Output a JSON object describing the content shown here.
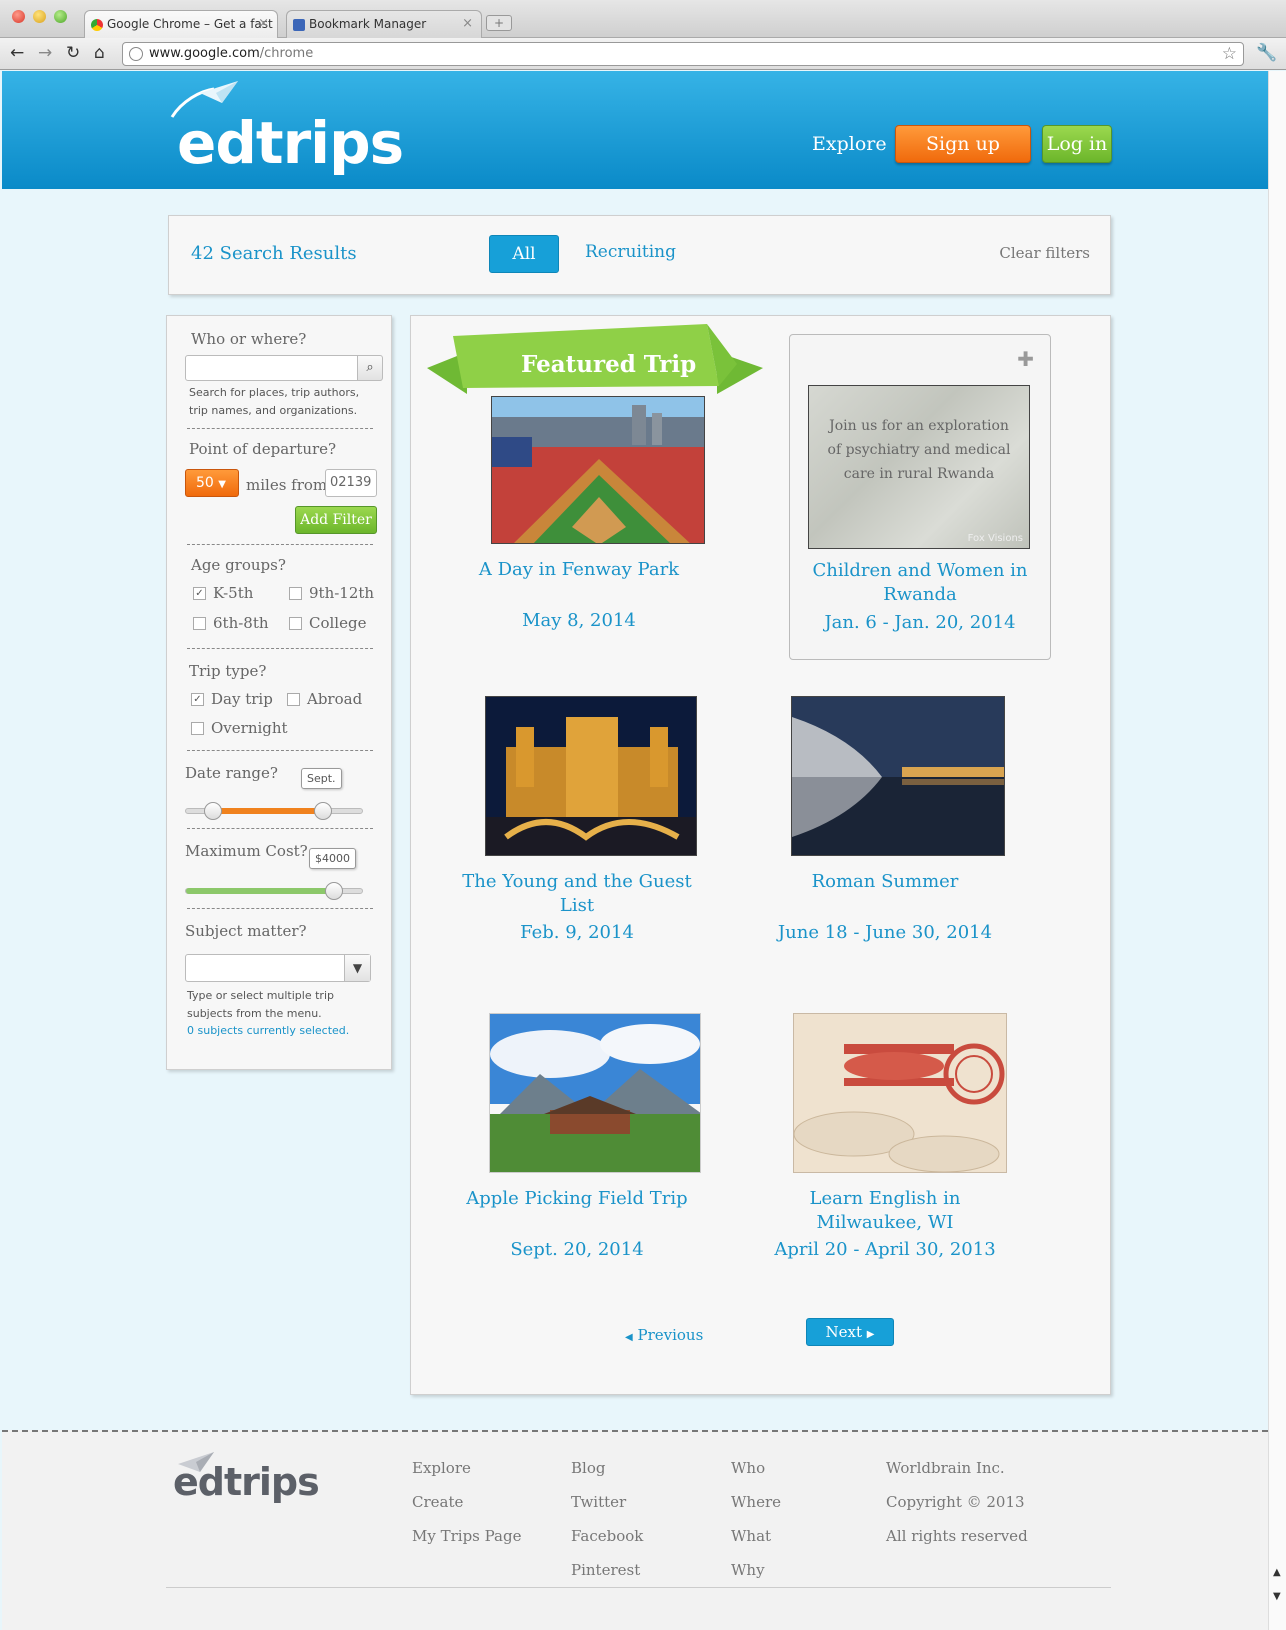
{
  "browser": {
    "tabs": [
      {
        "title": "Google Chrome – Get a fast ..."
      },
      {
        "title": "Bookmark Manager"
      }
    ],
    "url_host": "www.google.com",
    "url_path": "/chrome"
  },
  "header": {
    "logo": "edtrips",
    "explore": "Explore",
    "signup": "Sign up",
    "login": "Log in"
  },
  "results_bar": {
    "count": "42 Search Results",
    "tab_all": "All",
    "tab_recruiting": "Recruiting",
    "clear": "Clear filters"
  },
  "sidebar": {
    "who_label": "Who or where?",
    "who_help": "Search for places, trip authors, trip names, and organizations.",
    "departure_label": "Point of departure?",
    "miles_value": "50",
    "miles_text": "miles from",
    "zip_value": "02139",
    "add_filter": "Add Filter",
    "age_label": "Age groups?",
    "age_options": [
      {
        "label": "K-5th",
        "checked": true
      },
      {
        "label": "9th-12th",
        "checked": false
      },
      {
        "label": "6th-8th",
        "checked": false
      },
      {
        "label": "College",
        "checked": false
      }
    ],
    "trip_type_label": "Trip type?",
    "trip_type_options": [
      {
        "label": "Day trip",
        "checked": true
      },
      {
        "label": "Abroad",
        "checked": false
      },
      {
        "label": "Overnight",
        "checked": false
      }
    ],
    "date_label": "Date range?",
    "date_tooltip": "Sept.",
    "date_range": {
      "start": 0.15,
      "end": 0.77
    },
    "cost_label": "Maximum Cost?",
    "cost_tooltip": "$4000",
    "cost_level": 0.83,
    "subject_label": "Subject matter?",
    "subject_help": "Type or select multiple trip subjects from the menu.",
    "subject_status": "0 subjects currently selected."
  },
  "trips": {
    "featured_label": "Featured Trip",
    "items": [
      {
        "title": "A Day in Fenway Park",
        "date": "May 8, 2014"
      },
      {
        "title": "Children and Women in Rwanda",
        "date": "Jan. 6 - Jan. 20, 2014",
        "blurb": "Join us for an exploration of psychiatry and medical care in rural Rwanda",
        "credit": "Fox Visions"
      },
      {
        "title": "The Young and the Guest List",
        "date": "Feb. 9, 2014"
      },
      {
        "title": "Roman Summer",
        "date": "June 18 - June 30, 2014"
      },
      {
        "title": "Apple Picking Field Trip",
        "date": "Sept. 20, 2014"
      },
      {
        "title": "Learn English in Milwaukee, WI",
        "date": "April 20 - April 30, 2013"
      }
    ]
  },
  "pager": {
    "prev": "Previous",
    "next": "Next"
  },
  "footer": {
    "logo": "edtrips",
    "col1": [
      "Explore",
      "Create",
      "My Trips Page"
    ],
    "col2": [
      "Blog",
      "Twitter",
      "Facebook",
      "Pinterest"
    ],
    "col3": [
      "Who",
      "Where",
      "What",
      "Why"
    ],
    "col4": [
      "Worldbrain Inc.",
      "Copyright © 2013",
      "All rights reserved"
    ]
  }
}
